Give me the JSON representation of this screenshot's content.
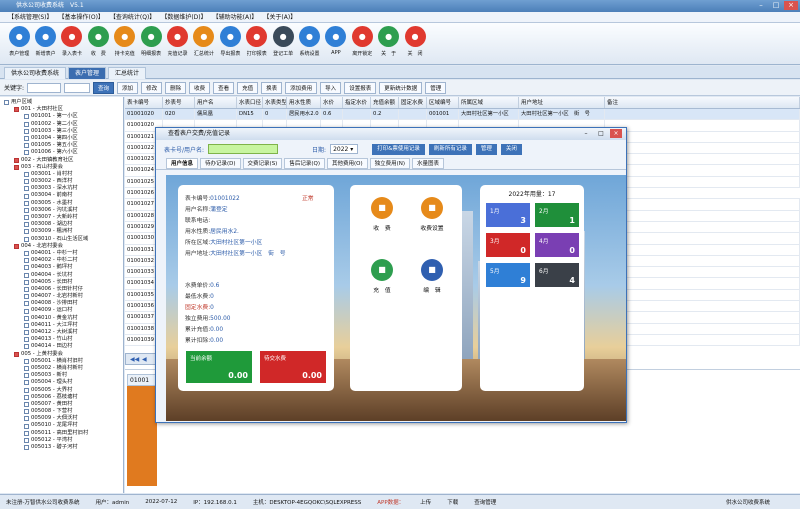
{
  "window": {
    "title": "供水公司收费系统　V5.1"
  },
  "menu": [
    "【系统管理(S)】",
    "【基本操作(O)】",
    "【查询统计(Q)】",
    "【数据维护(D)】",
    "【辅助功能(A)】",
    "【关于(A)】"
  ],
  "toolbar": [
    {
      "label": "表户管理",
      "icon": "users-icon",
      "color": "#2f7fd6"
    },
    {
      "label": "新增表户",
      "icon": "user-add-icon",
      "color": "#2f7fd6"
    },
    {
      "label": "录入表卡",
      "icon": "card-edit-icon",
      "color": "#e0392f"
    },
    {
      "label": "收　费",
      "icon": "money-icon",
      "color": "#2e9e4f"
    },
    {
      "label": "持卡充值",
      "icon": "charge-icon",
      "color": "#e68a1a"
    },
    {
      "label": "明细报表",
      "icon": "report-icon",
      "color": "#2e9e4f"
    },
    {
      "label": "充值记录",
      "icon": "record-icon",
      "color": "#e0392f"
    },
    {
      "label": "汇总统计",
      "icon": "chart-icon",
      "color": "#e68a1a"
    },
    {
      "label": "导出报表",
      "icon": "export-icon",
      "color": "#2f7fd6"
    },
    {
      "label": "打印报表",
      "icon": "print-icon",
      "color": "#e0392f"
    },
    {
      "label": "登记工单",
      "icon": "form-icon",
      "color": "#3a4a5a"
    },
    {
      "label": "系统设置",
      "icon": "gear-icon",
      "color": "#2f7fd6"
    },
    {
      "label": "APP",
      "icon": "app-icon",
      "color": "#2f7fd6"
    },
    {
      "label": "离开锁定",
      "icon": "lock-icon",
      "color": "#e0392f"
    },
    {
      "label": "关　于",
      "icon": "home-icon",
      "color": "#2e9e4f"
    },
    {
      "label": "关　闭",
      "icon": "power-icon",
      "color": "#e0392f"
    }
  ],
  "tabs": [
    {
      "label": "供水公司收费系统"
    },
    {
      "label": "表户管理"
    },
    {
      "label": "汇总统计"
    }
  ],
  "subbar": {
    "keyword_label": "关键字:",
    "buttons": [
      "查询",
      "添加",
      "修改",
      "删除",
      "收费",
      "查看",
      "充值",
      "换表",
      "添加费用",
      "导入",
      "设置报表",
      "更新统计数据",
      "管理"
    ]
  },
  "tree": [
    {
      "t": "用户区域",
      "l": 0,
      "g": 0
    },
    {
      "t": "001 - 大田村社区",
      "l": 1,
      "g": 1
    },
    {
      "t": "001001 - 第一小区",
      "l": 2,
      "g": 0
    },
    {
      "t": "001002 - 第二小区",
      "l": 2,
      "g": 0
    },
    {
      "t": "001003 - 第三小区",
      "l": 2,
      "g": 0
    },
    {
      "t": "001004 - 第四小区",
      "l": 2,
      "g": 0
    },
    {
      "t": "001005 - 第五小区",
      "l": 2,
      "g": 0
    },
    {
      "t": "001006 - 第六小区",
      "l": 2,
      "g": 0
    },
    {
      "t": "002 - 大田镇教育社区",
      "l": 1,
      "g": 1
    },
    {
      "t": "003 - 石山村委会",
      "l": 1,
      "g": 1
    },
    {
      "t": "003001 - 肖村村",
      "l": 2,
      "g": 0
    },
    {
      "t": "003002 - 西洋村",
      "l": 2,
      "g": 0
    },
    {
      "t": "003003 - 深水坑村",
      "l": 2,
      "g": 0
    },
    {
      "t": "003004 - 前南村",
      "l": 2,
      "g": 0
    },
    {
      "t": "003005 - 水墨村",
      "l": 2,
      "g": 0
    },
    {
      "t": "003006 - 沟坑溪村",
      "l": 2,
      "g": 0
    },
    {
      "t": "003007 - 大新岭村",
      "l": 2,
      "g": 0
    },
    {
      "t": "003008 - 湖边村",
      "l": 2,
      "g": 0
    },
    {
      "t": "003009 - 楓洲村",
      "l": 2,
      "g": 0
    },
    {
      "t": "003010 - 石山生活区域",
      "l": 2,
      "g": 0
    },
    {
      "t": "004 - 北岩村委会",
      "l": 1,
      "g": 1
    },
    {
      "t": "004001 - 中杉一村",
      "l": 2,
      "g": 0
    },
    {
      "t": "004002 - 中杉二村",
      "l": 2,
      "g": 0
    },
    {
      "t": "004003 - 鹅坪村",
      "l": 2,
      "g": 0
    },
    {
      "t": "004004 - 长坑村",
      "l": 2,
      "g": 0
    },
    {
      "t": "004005 - 长田村",
      "l": 2,
      "g": 0
    },
    {
      "t": "004006 - 长田针村仔",
      "l": 2,
      "g": 0
    },
    {
      "t": "004007 - 北岩村新村",
      "l": 2,
      "g": 0
    },
    {
      "t": "004008 - 沙排田村",
      "l": 2,
      "g": 0
    },
    {
      "t": "004009 - 运口村",
      "l": 2,
      "g": 0
    },
    {
      "t": "004010 - 黄金坑村",
      "l": 2,
      "g": 0
    },
    {
      "t": "004011 - 大江坪村",
      "l": 2,
      "g": 0
    },
    {
      "t": "004012 - 大树溪村",
      "l": 2,
      "g": 0
    },
    {
      "t": "004013 - 竹山村",
      "l": 2,
      "g": 0
    },
    {
      "t": "004014 - 田边村",
      "l": 2,
      "g": 0
    },
    {
      "t": "005 - 上黄村委会",
      "l": 1,
      "g": 1
    },
    {
      "t": "005001 - 横肖村旧村",
      "l": 2,
      "g": 0
    },
    {
      "t": "005002 - 横肖村新村",
      "l": 2,
      "g": 0
    },
    {
      "t": "005003 - 新村",
      "l": 2,
      "g": 0
    },
    {
      "t": "005004 - 理头村",
      "l": 2,
      "g": 0
    },
    {
      "t": "005005 - 大界村",
      "l": 2,
      "g": 0
    },
    {
      "t": "005006 - 荔枝塘村",
      "l": 2,
      "g": 0
    },
    {
      "t": "005007 - 黄田村",
      "l": 2,
      "g": 0
    },
    {
      "t": "005008 - 下营村",
      "l": 2,
      "g": 0
    },
    {
      "t": "005009 - 大佃沃村",
      "l": 2,
      "g": 0
    },
    {
      "t": "005010 - 龙尾坪村",
      "l": 2,
      "g": 0
    },
    {
      "t": "005011 - 高田里村旧村",
      "l": 2,
      "g": 0
    },
    {
      "t": "005012 - 平湾村",
      "l": 2,
      "g": 0
    },
    {
      "t": "005013 - 碧子河村",
      "l": 2,
      "g": 0
    }
  ],
  "grid": {
    "headers": [
      "表卡编号",
      "抄表号",
      "用户名",
      "水表口径",
      "水表类型",
      "用水性质",
      "水价",
      "指定水价",
      "充值余额",
      "固定水费",
      "区域编号",
      "所属区域",
      "用户地址",
      "备注"
    ],
    "rows": [
      [
        "01001020",
        "020",
        "儒凤凰",
        "DN15",
        "0",
        "居民用水2.0",
        "0.6",
        "",
        "0.2",
        "",
        "001001",
        "大田村社区第一小区",
        "大田村社区第一小区　街　号",
        ""
      ],
      [
        "01001020",
        "",
        "",
        "",
        "",
        "",
        "",
        "",
        "",
        "",
        "",
        "",
        "",
        ""
      ],
      [
        "01001021",
        "",
        "",
        "",
        "",
        "",
        "",
        "",
        "",
        "",
        "",
        "",
        "",
        ""
      ],
      [
        "01001022",
        "",
        "",
        "",
        "",
        "",
        "",
        "",
        "",
        "",
        "",
        "",
        "",
        ""
      ],
      [
        "01001023",
        "",
        "",
        "",
        "",
        "",
        "",
        "",
        "",
        "",
        "",
        "",
        "",
        ""
      ],
      [
        "01001024",
        "",
        "",
        "",
        "",
        "",
        "",
        "",
        "",
        "",
        "",
        "",
        "",
        ""
      ],
      [
        "01001025",
        "",
        "",
        "",
        "",
        "",
        "",
        "",
        "",
        "",
        "",
        "",
        "",
        ""
      ],
      [
        "01001026",
        "",
        "",
        "",
        "",
        "",
        "",
        "",
        "",
        "",
        "",
        "",
        "原户主：郑新健（之前登记漏）"
      ],
      [
        "01001027",
        "",
        "",
        "",
        "",
        "",
        "",
        "",
        "",
        "",
        "",
        "",
        "",
        ""
      ],
      [
        "01001028",
        "",
        "",
        "",
        "",
        "",
        "",
        "",
        "",
        "",
        "",
        "",
        "",
        ""
      ],
      [
        "01001029",
        "",
        "",
        "",
        "",
        "",
        "",
        "",
        "",
        "",
        "",
        "",
        "",
        ""
      ],
      [
        "01001030",
        "",
        "",
        "",
        "",
        "",
        "",
        "",
        "",
        "",
        "",
        "",
        "",
        ""
      ],
      [
        "01001031",
        "",
        "",
        "",
        "",
        "",
        "",
        "",
        "",
        "",
        "",
        "",
        "",
        ""
      ],
      [
        "01001032",
        "",
        "",
        "",
        "",
        "",
        "",
        "",
        "",
        "",
        "",
        "",
        "",
        ""
      ],
      [
        "01001033",
        "",
        "",
        "",
        "",
        "",
        "",
        "",
        "",
        "",
        "",
        "",
        "",
        ""
      ],
      [
        "01001034",
        "",
        "",
        "",
        "",
        "",
        "",
        "",
        "",
        "",
        "",
        "",
        "",
        ""
      ],
      [
        "01001035",
        "",
        "",
        "",
        "",
        "",
        "",
        "",
        "",
        "",
        "",
        "",
        "",
        ""
      ],
      [
        "01001036",
        "",
        "",
        "",
        "",
        "",
        "",
        "",
        "",
        "",
        "",
        "",
        "",
        ""
      ],
      [
        "01001037",
        "",
        "",
        "",
        "",
        "",
        "",
        "",
        "",
        "",
        "",
        "",
        "",
        ""
      ],
      [
        "01001038",
        "",
        "",
        "",
        "",
        "",
        "",
        "",
        "",
        "",
        "",
        "",
        "",
        ""
      ],
      [
        "01001039",
        "",
        "",
        "",
        "",
        "",
        "",
        "",
        "",
        "",
        "",
        "",
        "",
        ""
      ]
    ],
    "foot_label": "01001"
  },
  "dialog": {
    "title": "查看表户交费/充值记录",
    "search_label": "表卡号/用户名:",
    "date_label": "日期:",
    "year": "2022",
    "buttons": [
      "打印&票使用记录",
      "刷新所有记录",
      "管理",
      "关闭"
    ],
    "tabs": [
      "用户信息",
      "待办记录(D)",
      "交费记录(S)",
      "售后记录(Q)",
      "其他费用(O)",
      "独立费用(N)",
      "水量图表"
    ],
    "info": {
      "rows": [
        {
          "k": "表卡编号:",
          "v": "01001022"
        },
        {
          "k": "用户名称:",
          "v": "蒲登定"
        },
        {
          "k": "联系电话:",
          "v": ""
        },
        {
          "k": "用水性质:",
          "v": "居民用水2."
        },
        {
          "k": "所在区域:",
          "v": "大田村社区第一小区"
        },
        {
          "k": "用户地址:",
          "v": "大田村社区第一小区　街　号"
        }
      ],
      "status": "正常",
      "rows2": [
        {
          "k": "水费单价:",
          "v": "0.6",
          "red": false
        },
        {
          "k": "最低水费:",
          "v": "0",
          "red": false
        },
        {
          "k": "固定水费:",
          "v": "0",
          "red": true
        },
        {
          "k": "独立费用:",
          "v": "500.00",
          "red": false
        },
        {
          "k": "累计充值:",
          "v": "0.00",
          "red": false
        },
        {
          "k": "累计扣除:",
          "v": "0.00",
          "red": false
        }
      ],
      "balance_label": "当前余额",
      "balance": "0.00",
      "pending_label": "待交水费",
      "pending": "0.00"
    },
    "actions": [
      {
        "label": "收　费",
        "icon": "money-icon",
        "color": "#e68a1a"
      },
      {
        "label": "收费设置",
        "icon": "calculator-icon",
        "color": "#e68a1a"
      },
      {
        "label": "充　值",
        "icon": "charge-icon",
        "color": "#2e9e4f"
      },
      {
        "label": "编　辑",
        "icon": "edit-icon",
        "color": "#2f5fb0"
      }
    ],
    "usage": {
      "title": "2022年用量：17",
      "months": [
        {
          "m": "1月",
          "v": "3",
          "color": "#4a6fd8"
        },
        {
          "m": "2月",
          "v": "1",
          "color": "#1f8f3a"
        },
        {
          "m": "3月",
          "v": "0",
          "color": "#d02828"
        },
        {
          "m": "4月",
          "v": "0",
          "color": "#7a3fb3"
        },
        {
          "m": "5月",
          "v": "9",
          "color": "#2f7fd6"
        },
        {
          "m": "6月",
          "v": "4",
          "color": "#3a4048"
        }
      ]
    }
  },
  "statusbar": [
    "未注册-万智供水公司收费系统",
    "用户：admin",
    "2022-07-12",
    "IP：192.168.0.1",
    "主机：DESKTOP-4EGQOKC\\SQLEXPRESS",
    "APP数据：",
    "上传",
    "下载",
    "查询管理",
    "供水公司收费系统"
  ]
}
